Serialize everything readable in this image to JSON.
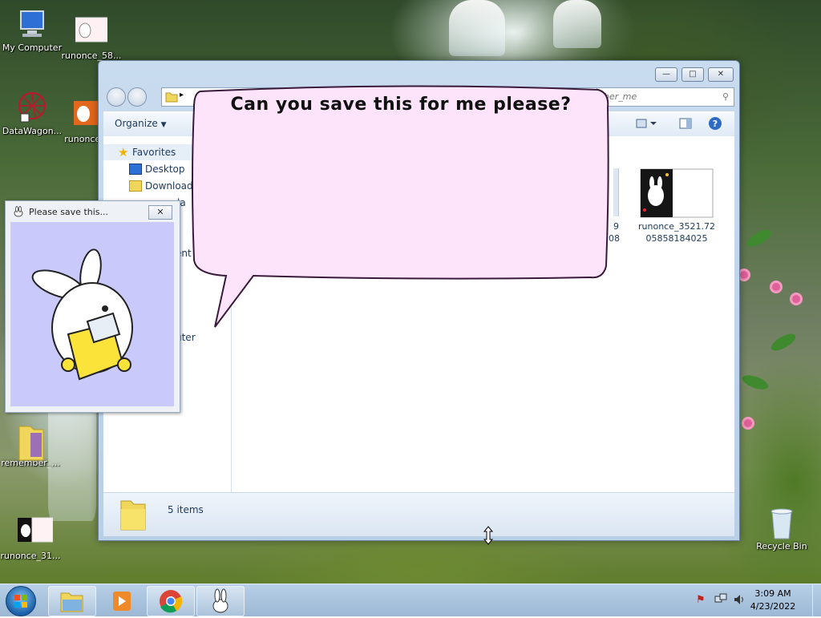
{
  "desktop": {
    "icons": [
      {
        "label": "My Computer"
      },
      {
        "label": "runonce_58..."
      },
      {
        "label": "DataWagon..."
      },
      {
        "label": "runonce..."
      },
      {
        "label": "remember_..."
      },
      {
        "label": "runonce_31..."
      },
      {
        "label": "Recycle Bin"
      }
    ]
  },
  "explorer": {
    "search_placeholder": "ber_me",
    "toolbar": {
      "organize": "Organize"
    },
    "nav": {
      "favorites": "Favorites",
      "desktop": "Desktop",
      "downloads": "Download",
      "partial_1": "la",
      "partial_2": "ent",
      "partial_3": "uter"
    },
    "files": [
      {
        "name": "runonce_3521.72\n05858184025"
      },
      {
        "name_partial_1": "9",
        "name_partial_2": "08"
      }
    ],
    "status": {
      "item_count": "5 items"
    }
  },
  "bubble": {
    "text": "Can you save this for me please?"
  },
  "popup": {
    "title": "Please save this...",
    "close": "✕"
  },
  "taskbar": {
    "clock": {
      "time": "3:09 AM",
      "date": "4/23/2022"
    }
  },
  "colors": {
    "bubble_fill": "#fde4fb",
    "popup_bg": "#c9c9fb",
    "folder": "#f7e36a"
  }
}
